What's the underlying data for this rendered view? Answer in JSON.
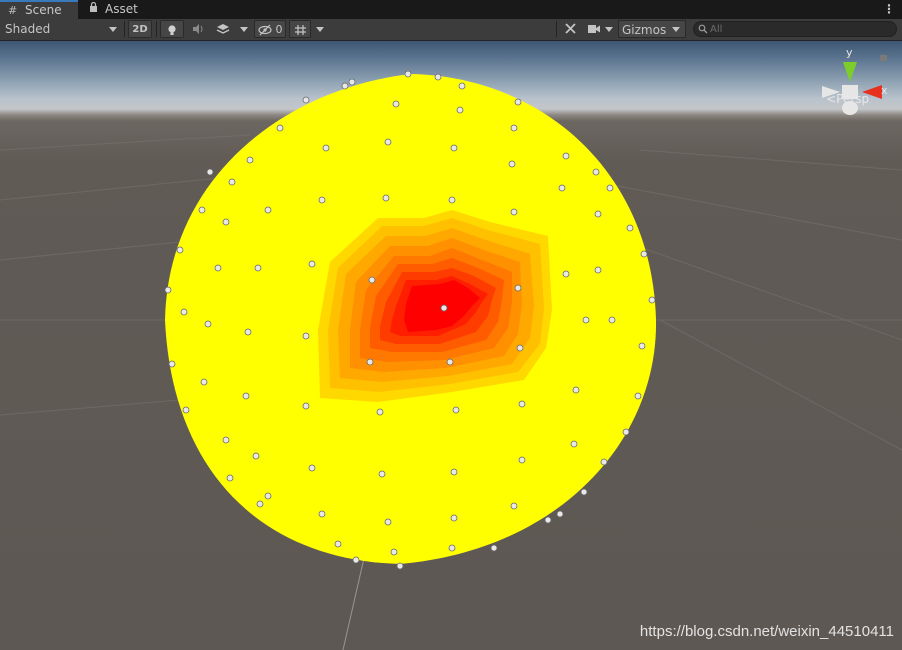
{
  "tabs": [
    {
      "label": "Scene",
      "icon": "grid-icon"
    },
    {
      "label": "Asset Store",
      "icon": "bag-icon"
    }
  ],
  "toolbar": {
    "draw_mode": "Shaded",
    "mode_2d": "2D",
    "hidden_count": "0",
    "gizmos": "Gizmos",
    "search_placeholder": "All"
  },
  "gizmo": {
    "y_label": "y",
    "x_label": "x",
    "projection": "Persp"
  },
  "watermark": "https://blog.csdn.net/weixin_44510411",
  "colors": {
    "sphere": "#ffff00",
    "hot_center": "#ff0000",
    "ground": "#5e5854",
    "accent_tab": "#3a79bb"
  }
}
